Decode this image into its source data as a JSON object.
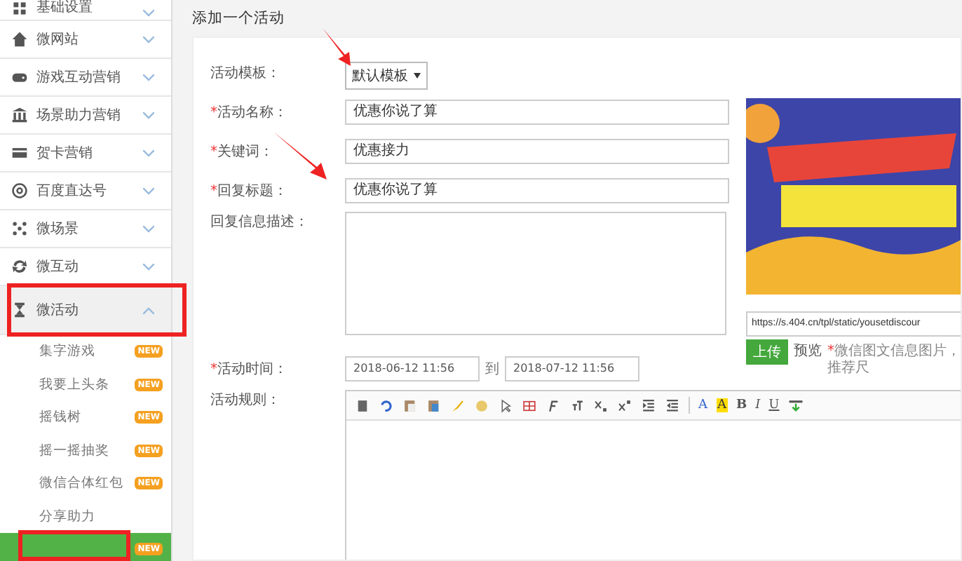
{
  "sidebar": {
    "items": [
      {
        "label": "基础设置",
        "expanded": false,
        "selected": false
      },
      {
        "label": "微网站",
        "expanded": false,
        "selected": false
      },
      {
        "label": "游戏互动营销",
        "expanded": false,
        "selected": false
      },
      {
        "label": "场景助力营销",
        "expanded": false,
        "selected": false
      },
      {
        "label": "贺卡营销",
        "expanded": false,
        "selected": false
      },
      {
        "label": "百度直达号",
        "expanded": false,
        "selected": false
      },
      {
        "label": "微场景",
        "expanded": false,
        "selected": false
      },
      {
        "label": "微互动",
        "expanded": false,
        "selected": false
      },
      {
        "label": "微活动",
        "expanded": true,
        "selected": true,
        "children": [
          {
            "label": "集字游戏",
            "badge": "NEW",
            "selected": false
          },
          {
            "label": "我要上头条",
            "badge": "NEW",
            "selected": false
          },
          {
            "label": "摇钱树",
            "badge": "NEW",
            "selected": false
          },
          {
            "label": "摇一摇抽奖",
            "badge": "NEW",
            "selected": false
          },
          {
            "label": "微信合体红包",
            "badge": "NEW",
            "selected": false
          },
          {
            "label": "分享助力",
            "selected": false
          },
          {
            "badge": "NEW",
            "selected": true
          }
        ]
      }
    ]
  },
  "page_title": "添加一个活动",
  "form": {
    "template": {
      "label": "活动模板：",
      "value": "默认模板"
    },
    "fields": [
      {
        "marker": "*",
        "label": "活动名称：",
        "value": "优惠你说了算"
      },
      {
        "marker": "*",
        "label": "关键词：",
        "value": "优惠接力"
      },
      {
        "marker": "*",
        "label": "回复标题：",
        "value": "优惠你说了算"
      }
    ],
    "description": {
      "label": "回复信息描述："
    },
    "image": {
      "url": "https://s.404.cn/tpl/static/yousetdiscour",
      "upload_button": "上传",
      "preview_link": "预览",
      "hint_marker": "*",
      "hint": "微信图文信息图片，推荐尺"
    },
    "time": {
      "marker": "*",
      "label": "活动时间：",
      "start": "2018-06-12 11:56",
      "separator": "到",
      "end": "2018-07-12 11:56"
    },
    "rules": {
      "label": "活动规则：",
      "toolbar": [
        {
          "kind": "icon"
        },
        {
          "kind": "icon"
        },
        {
          "kind": "icon"
        },
        {
          "kind": "icon"
        },
        {
          "kind": "icon"
        },
        {
          "kind": "icon"
        },
        {
          "kind": "icon"
        },
        {
          "kind": "icon"
        },
        {
          "kind": "icon"
        },
        {
          "kind": "icon"
        },
        {
          "kind": "icon"
        },
        {
          "kind": "icon"
        },
        {
          "kind": "icon"
        },
        {
          "kind": "icon"
        },
        {
          "kind": "sep"
        },
        {
          "kind": "text",
          "label": "A"
        },
        {
          "kind": "text",
          "label": "A"
        },
        {
          "kind": "text",
          "label": "B"
        },
        {
          "kind": "text",
          "label": "I"
        },
        {
          "kind": "text",
          "label": "U"
        },
        {
          "kind": "icon"
        }
      ]
    }
  }
}
